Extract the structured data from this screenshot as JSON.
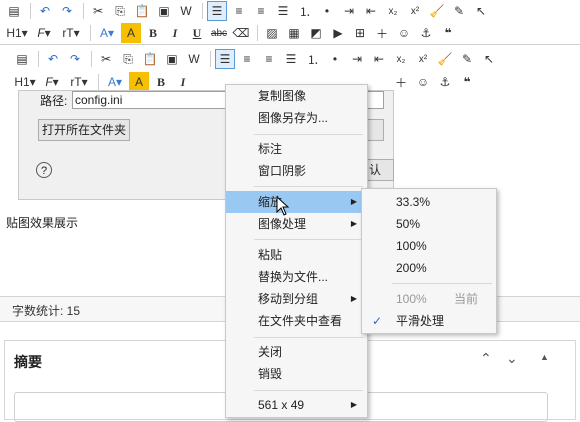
{
  "toolbar_top": {
    "row1": [
      "source-icon",
      "undo-icon",
      "redo-icon",
      "cut-icon",
      "copy-icon",
      "paste-icon",
      "paste-text-icon",
      "paste-word-icon",
      "align-left-icon",
      "align-center-icon",
      "align-right-icon",
      "justify-icon",
      "ordered-list-icon",
      "unordered-list-icon",
      "indent-icon",
      "outdent-icon",
      "subscript-icon",
      "superscript-icon",
      "clean-icon",
      "format-painter-icon",
      "select-icon"
    ],
    "row2_labels": {
      "heading": "H1",
      "font": "F",
      "size": "rT",
      "fontcolor": "A",
      "bgcolor": "A",
      "bold": "B",
      "italic": "I",
      "underline": "U"
    }
  },
  "dialog": {
    "path_label": "路径:",
    "path_value": "config.ini",
    "open_folder": "打开所在文件夹",
    "help": "?",
    "confirm_fragment": "认"
  },
  "caption": "贴图效果展示",
  "word_count": "字数统计: 15",
  "summary": {
    "title": "摘要"
  },
  "context_menu": {
    "items": [
      {
        "label": "复制图像"
      },
      {
        "label": "图像另存为..."
      },
      {
        "label": "标注"
      },
      {
        "label": "窗口阴影"
      },
      {
        "label": "缩放"
      },
      {
        "label": "图像处理"
      },
      {
        "label": "粘贴"
      },
      {
        "label": "替换为文件..."
      },
      {
        "label": "移动到分组"
      },
      {
        "label": "在文件夹中查看"
      },
      {
        "label": "关闭"
      },
      {
        "label": "销毁"
      },
      {
        "label": "561 x 49"
      }
    ]
  },
  "zoom_submenu": {
    "items": [
      {
        "label": "33.3%"
      },
      {
        "label": "50%"
      },
      {
        "label": "100%"
      },
      {
        "label": "200%"
      },
      {
        "label": "100%",
        "hint": "当前"
      },
      {
        "label": "平滑处理",
        "checked": "✓"
      }
    ]
  },
  "colors": {
    "highlight": "#99c9f2",
    "font_color_accent": "#3a7bd5",
    "bg_color_accent": "#f6c000"
  }
}
